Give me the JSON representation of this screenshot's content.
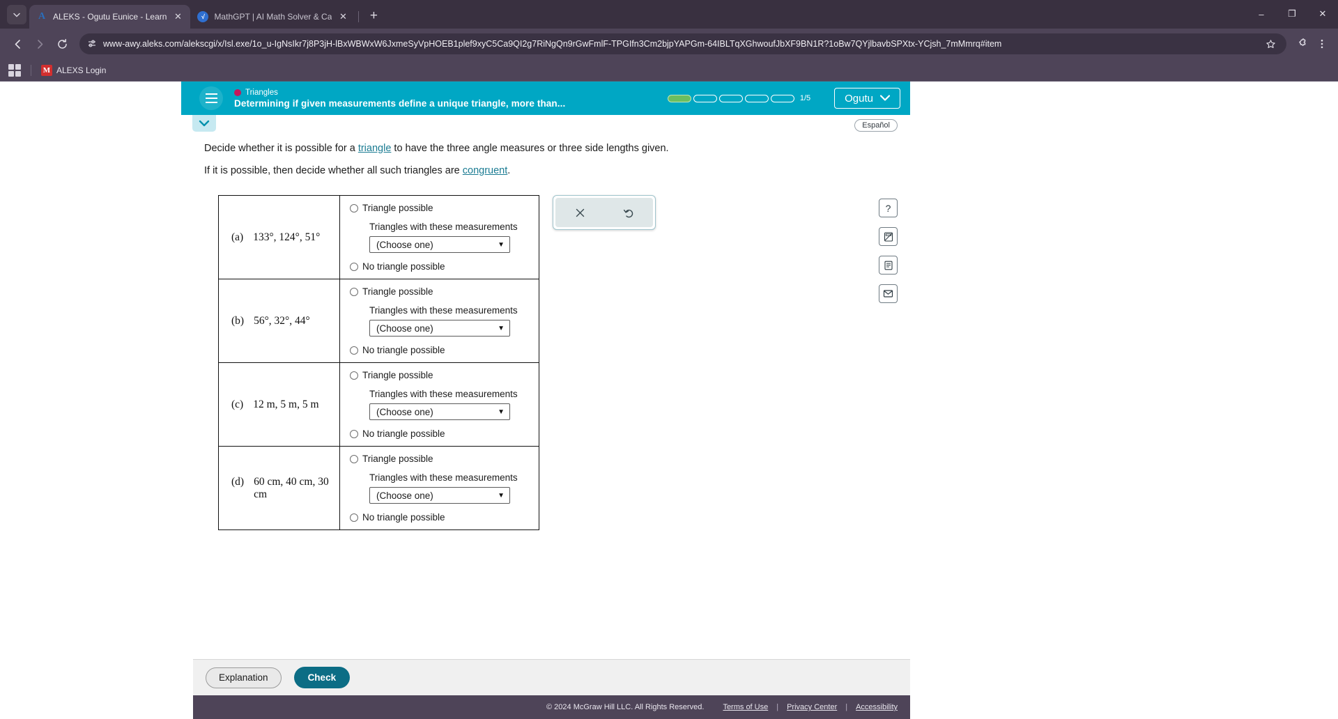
{
  "browser": {
    "tabs": [
      {
        "title": "ALEKS - Ogutu Eunice - Learn",
        "favicon": "aleks-a-icon",
        "active": true
      },
      {
        "title": "MathGPT | AI Math Solver & Ca",
        "favicon": "mathgpt-icon",
        "active": false
      }
    ],
    "new_tab_label": "+",
    "tab_list_icon": "chevron-down-icon",
    "window_controls": {
      "minimize": "–",
      "maximize": "❐",
      "close": "✕"
    },
    "nav": {
      "back": "←",
      "forward": "→",
      "reload": "⟳"
    },
    "url": "www-awy.aleks.com/alekscgi/x/Isl.exe/1o_u-IgNsIkr7j8P3jH-lBxWBWxW6JxmeSyVpHOEB1plef9xyC5Ca9QI2g7RiNgQn9rGwFmlF-TPGIfn3Cm2bjpYAPGm-64IBLTqXGhwoufJbXF9BN1R?1oBw7QYjlbavbSPXtx-YCjsh_7mMmrq#item",
    "site_info_icon": "site-settings-icon",
    "bookmark_star_icon": "star-icon",
    "extensions_icon": "puzzle-icon",
    "menu_icon": "kebab-menu-icon",
    "bookmarks": {
      "apps_icon": "apps-grid-icon",
      "items": [
        {
          "label": "ALEXS Login",
          "favicon_letter": "M"
        }
      ]
    }
  },
  "aleks": {
    "header": {
      "menu_icon": "hamburger-menu-icon",
      "topic": "Triangles",
      "topic_dot_color": "#c2185b",
      "lesson_title": "Determining if given measurements define a unique triangle, more than...",
      "progress": {
        "total": 5,
        "filled": 1,
        "count_label": "1/5"
      },
      "user_name": "Ogutu",
      "user_caret": "⌄",
      "background_color": "#00a7c4"
    },
    "question": {
      "collapse_icon": "chevron-down-icon",
      "language_toggle": "Español",
      "prompt_line1_before": "Decide whether it is possible for a ",
      "prompt_line1_link": "triangle",
      "prompt_line1_after": " to have the three angle measures or three side lengths given.",
      "prompt_line2_before": "If it is possible, then decide whether all such triangles are ",
      "prompt_line2_link": "congruent",
      "prompt_line2_after": ".",
      "rows": [
        {
          "key": "(a)",
          "measurements": "133°, 124°, 51°",
          "option_possible": "Triangle possible",
          "sub_label": "Triangles with these measurements",
          "select_value": "(Choose one)",
          "option_impossible": "No triangle possible"
        },
        {
          "key": "(b)",
          "measurements": "56°, 32°, 44°",
          "option_possible": "Triangle possible",
          "sub_label": "Triangles with these measurements",
          "select_value": "(Choose one)",
          "option_impossible": "No triangle possible"
        },
        {
          "key": "(c)",
          "measurements": "12 m, 5 m, 5 m",
          "option_possible": "Triangle possible",
          "sub_label": "Triangles with these measurements",
          "select_value": "(Choose one)",
          "option_impossible": "No triangle possible"
        },
        {
          "key": "(d)",
          "measurements": "60 cm, 40 cm, 30 cm",
          "option_possible": "Triangle possible",
          "sub_label": "Triangles with these measurements",
          "select_value": "(Choose one)",
          "option_impossible": "No triangle possible"
        }
      ]
    },
    "tool_palette": {
      "clear_icon": "close-x-icon",
      "undo_icon": "undo-arrow-icon"
    },
    "icon_rail": [
      {
        "icon": "help-question-icon",
        "glyph": "?"
      },
      {
        "icon": "calculator-icon",
        "glyph": "⛶"
      },
      {
        "icon": "reference-sheet-icon",
        "glyph": "▤"
      },
      {
        "icon": "envelope-message-icon",
        "glyph": "✉"
      }
    ],
    "actions": {
      "explanation_label": "Explanation",
      "check_label": "Check"
    },
    "footer": {
      "copyright": "© 2024 McGraw Hill LLC. All Rights Reserved.",
      "links": [
        "Terms of Use",
        "Privacy Center",
        "Accessibility"
      ],
      "separator": "|"
    }
  }
}
